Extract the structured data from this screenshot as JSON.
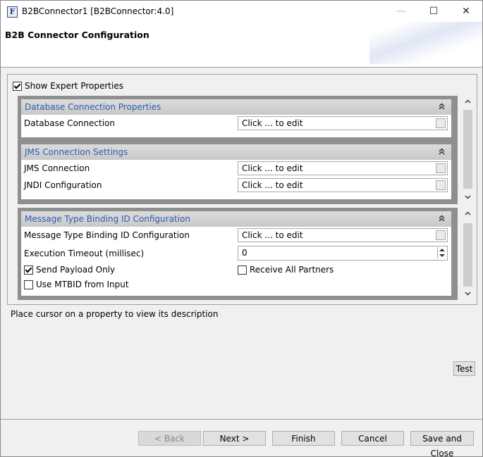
{
  "window": {
    "title": "B2BConnector1 [B2BConnector:4.0]",
    "app_icon_letter": "F",
    "minimize_symbol": "—",
    "maximize_symbol": "☐",
    "close_symbol": "✕"
  },
  "header": {
    "title": "B2B Connector Configuration"
  },
  "options": {
    "show_expert_label": "Show Expert Properties",
    "show_expert_checked": true
  },
  "sections": {
    "database": {
      "title": "Database Connection Properties",
      "rows": [
        {
          "label": "Database Connection",
          "value": "Click ... to edit"
        }
      ]
    },
    "jms": {
      "title": "JMS Connection Settings",
      "rows": [
        {
          "label": "JMS Connection",
          "value": "Click ... to edit"
        },
        {
          "label": "JNDI Configuration",
          "value": "Click ... to edit"
        }
      ]
    },
    "mtbid": {
      "title": "Message Type Binding ID Configuration",
      "binding_label": "Message Type Binding ID Configuration",
      "binding_value": "Click ... to edit",
      "timeout_label": "Execution Timeout (millisec)",
      "timeout_value": "0",
      "send_payload_label": "Send Payload Only",
      "send_payload_checked": true,
      "receive_all_label": "Receive All Partners",
      "receive_all_checked": false,
      "use_mtbid_label": "Use MTBID from Input",
      "use_mtbid_checked": false
    }
  },
  "description": "Place cursor on a property to view its description",
  "buttons": {
    "test": "Test",
    "back": "< Back",
    "next": "Next >",
    "finish": "Finish",
    "cancel": "Cancel",
    "save_close": "Save and Close"
  },
  "icons": {
    "collapse": "collapse-up-icon",
    "scroll_up": "▲",
    "scroll_down": "▼"
  }
}
